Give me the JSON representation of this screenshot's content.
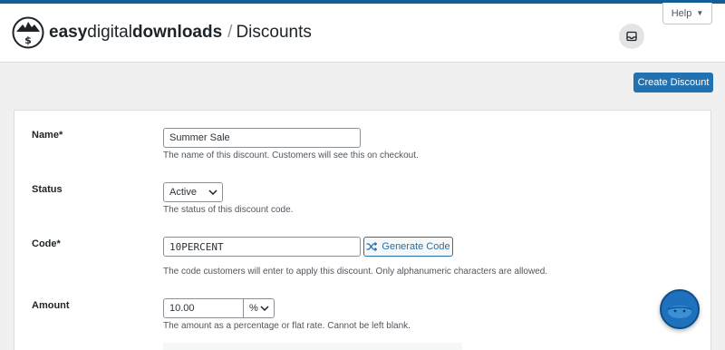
{
  "header": {
    "brand_light": "easy",
    "brand_mid": "digital",
    "brand_bold": "downloads",
    "separator": "/",
    "page_title": "Discounts",
    "help_label": "Help",
    "help_caret": "▼"
  },
  "toolbar": {
    "create_label": "Create Discount"
  },
  "form": {
    "name": {
      "label": "Name*",
      "value": "Summer Sale",
      "description": "The name of this discount. Customers will see this on checkout."
    },
    "status": {
      "label": "Status",
      "selected": "Active",
      "description": "The status of this discount code."
    },
    "code": {
      "label": "Code*",
      "value": "10PERCENT",
      "generate_label": "Generate Code",
      "description": "The code customers will enter to apply this discount. Only alphanumeric characters are allowed."
    },
    "amount": {
      "label": "Amount",
      "value": "10.00",
      "type_selected": "%",
      "description": "The amount as a percentage or flat rate. Cannot be left blank."
    }
  },
  "colors": {
    "accent": "#2271b1",
    "topbar": "#135e96",
    "background": "#f0f0f1"
  },
  "icons": {
    "logo": "edd-logo-icon",
    "inbox": "inbox-icon",
    "shuffle": "shuffle-icon",
    "chevron": "chevron-down-icon",
    "chat": "chat-bubble-icon"
  }
}
